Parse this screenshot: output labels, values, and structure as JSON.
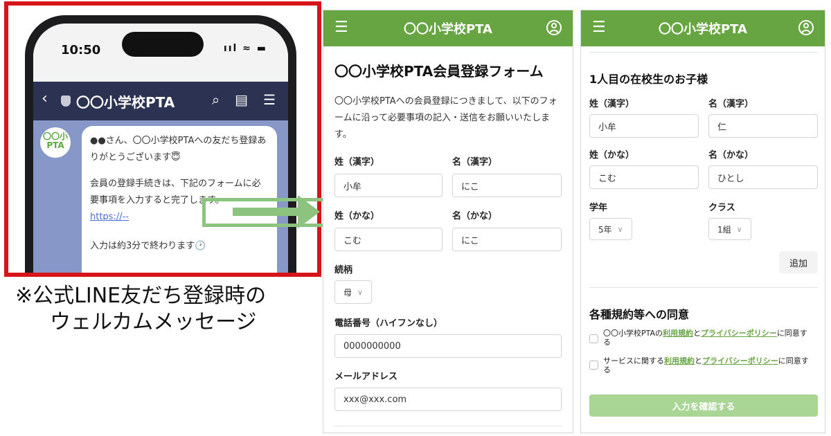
{
  "phone": {
    "time": "10:50",
    "signal": "ııl ≈ ▬",
    "line_title": "〇〇小学校PTA",
    "avatar_line1": "〇〇小",
    "avatar_line2": "PTA",
    "msg1": "●●さん、〇〇小学校PTAへの友だち登録ありがとうございます😇",
    "msg2": "会員の登録手続きは、下記のフォームに必要事項を入力すると完了します。",
    "link": "https://--",
    "msg3": "入力は約3分で終わります🕑"
  },
  "caption": {
    "line1": "※公式LINE友だち登録時の",
    "line2": "ウェルカムメッセージ"
  },
  "app_title": "〇〇小学校PTA",
  "form1": {
    "title": "〇〇小学校PTA会員登録フォーム",
    "intro": "〇〇小学校PTAへの会員登録につきまして、以下のフォームに沿って必要事項の記入・送信をお願いいたします。",
    "last_kanji_label": "姓（漢字）",
    "last_kanji_value": "小牟",
    "first_kanji_label": "名（漢字）",
    "first_kanji_value": "にこ",
    "last_kana_label": "姓（かな）",
    "last_kana_value": "こむ",
    "first_kana_label": "名（かな）",
    "first_kana_value": "にこ",
    "relation_label": "続柄",
    "relation_value": "母",
    "phone_label": "電話番号（ハイフンなし）",
    "phone_value": "0000000000",
    "email_label": "メールアドレス",
    "email_value": "xxx@xxx.com"
  },
  "form2": {
    "child_title": "1人目の在校生のお子様",
    "last_kanji_label": "姓（漢字）",
    "last_kanji_value": "小牟",
    "first_kanji_label": "名（漢字）",
    "first_kanji_value": "仁",
    "last_kana_label": "姓（かな）",
    "last_kana_value": "こむ",
    "first_kana_label": "名（かな）",
    "first_kana_value": "ひとし",
    "grade_label": "学年",
    "grade_value": "5年",
    "class_label": "クラス",
    "class_value": "1組",
    "add_button": "追加",
    "agree_title": "各種規約等への同意",
    "agree1_pre": "〇〇小学校PTAの",
    "agree1_link1": "利用規約",
    "agree1_mid": "と",
    "agree1_link2": "プライバシーポリシー",
    "agree1_post": "に同意する",
    "agree2_pre": "サービスに関する",
    "agree2_link1": "利用規約",
    "agree2_mid": "と",
    "agree2_link2": "プライバシーポリシー",
    "agree2_post": "に同意する",
    "confirm_button": "入力を確認する"
  }
}
